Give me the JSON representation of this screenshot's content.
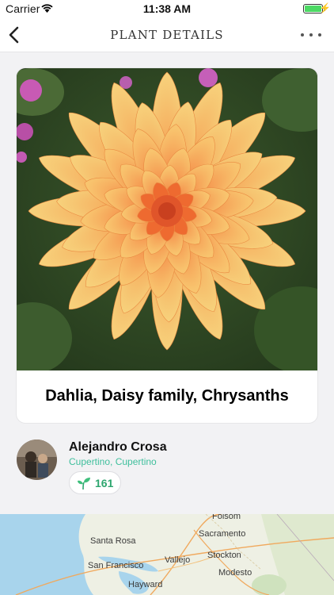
{
  "status_bar": {
    "carrier": "Carrier",
    "time": "11:38 AM",
    "battery_level": 1.0,
    "charging_glyph": "⚡"
  },
  "nav": {
    "title": "PLANT DETAILS",
    "back_icon": "chevron-left-icon",
    "more_icon": "more-horizontal-icon"
  },
  "plant": {
    "name": "Dahlia, Daisy family, Chrysanths",
    "photo": "orange-dahlia-flower-photo"
  },
  "author": {
    "name": "Alejandro Crosa",
    "location": "Cupertino, Cupertino",
    "likes": "161",
    "likes_icon": "sprout-icon"
  },
  "map": {
    "cities": [
      "Folsom",
      "Sacramento",
      "Santa Rosa",
      "Stockton",
      "San Francisco",
      "Vallejo",
      "Modesto",
      "Hayward"
    ]
  },
  "colors": {
    "accent_teal": "#3fbf9c",
    "likes_green": "#2ea66f",
    "battery_green": "#4cd964",
    "background": "#f2f2f4"
  }
}
